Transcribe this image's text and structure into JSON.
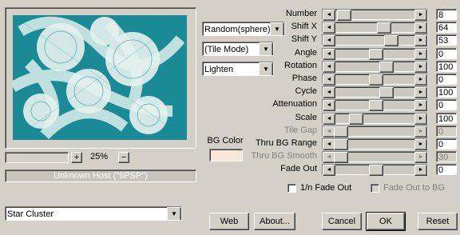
{
  "preview": {
    "zoom_value": "25%",
    "zoom_in": "+",
    "zoom_out": "−",
    "host_text": "Unknown Host (\"9PSP\")",
    "bg_color_label": "BG Color",
    "bg_color": "#f8e8dc"
  },
  "dropdowns": {
    "shape": "Random(sphere)",
    "tile": "(Tile Mode)",
    "blend": "Lighten",
    "preset": "Star Cluster"
  },
  "sliders": [
    {
      "label": "Number",
      "value": "8",
      "level": 0.05,
      "disabled": false
    },
    {
      "label": "Shift X",
      "value": "64",
      "level": 0.62,
      "disabled": false
    },
    {
      "label": "Shift Y",
      "value": "53",
      "level": 0.72,
      "disabled": false
    },
    {
      "label": "Angle",
      "value": "0",
      "level": 0.5,
      "disabled": false
    },
    {
      "label": "Rotation",
      "value": "100",
      "level": 0.66,
      "disabled": false
    },
    {
      "label": "Phase",
      "value": "0",
      "level": 0.5,
      "disabled": false
    },
    {
      "label": "Cycle",
      "value": "100",
      "level": 0.66,
      "disabled": false
    },
    {
      "label": "Attenuation",
      "value": "0",
      "level": 0.5,
      "disabled": false
    },
    {
      "label": "Scale",
      "value": "100",
      "level": 0.22,
      "disabled": false
    },
    {
      "label": "Tile Gap",
      "value": "0",
      "level": 0.0,
      "disabled": true
    },
    {
      "label": "Thru BG Range",
      "value": "0",
      "level": 0.0,
      "disabled": false
    },
    {
      "label": "Thru BG Smooth",
      "value": "30",
      "level": 0.0,
      "disabled": true
    },
    {
      "label": "Fade Out",
      "value": "0",
      "level": 0.5,
      "disabled": false
    }
  ],
  "checkboxes": {
    "fade_1n": "1/n Fade Out",
    "fade_to_bg": "Fade Out to BG"
  },
  "buttons": {
    "web": "Web",
    "about": "About...",
    "cancel": "Cancel",
    "ok": "OK",
    "reset": "Reset"
  },
  "colors": {
    "preview_teal": "#1a8a96",
    "preview_light": "#d8ece8",
    "thumb_disabled": "#d4d0c8"
  }
}
